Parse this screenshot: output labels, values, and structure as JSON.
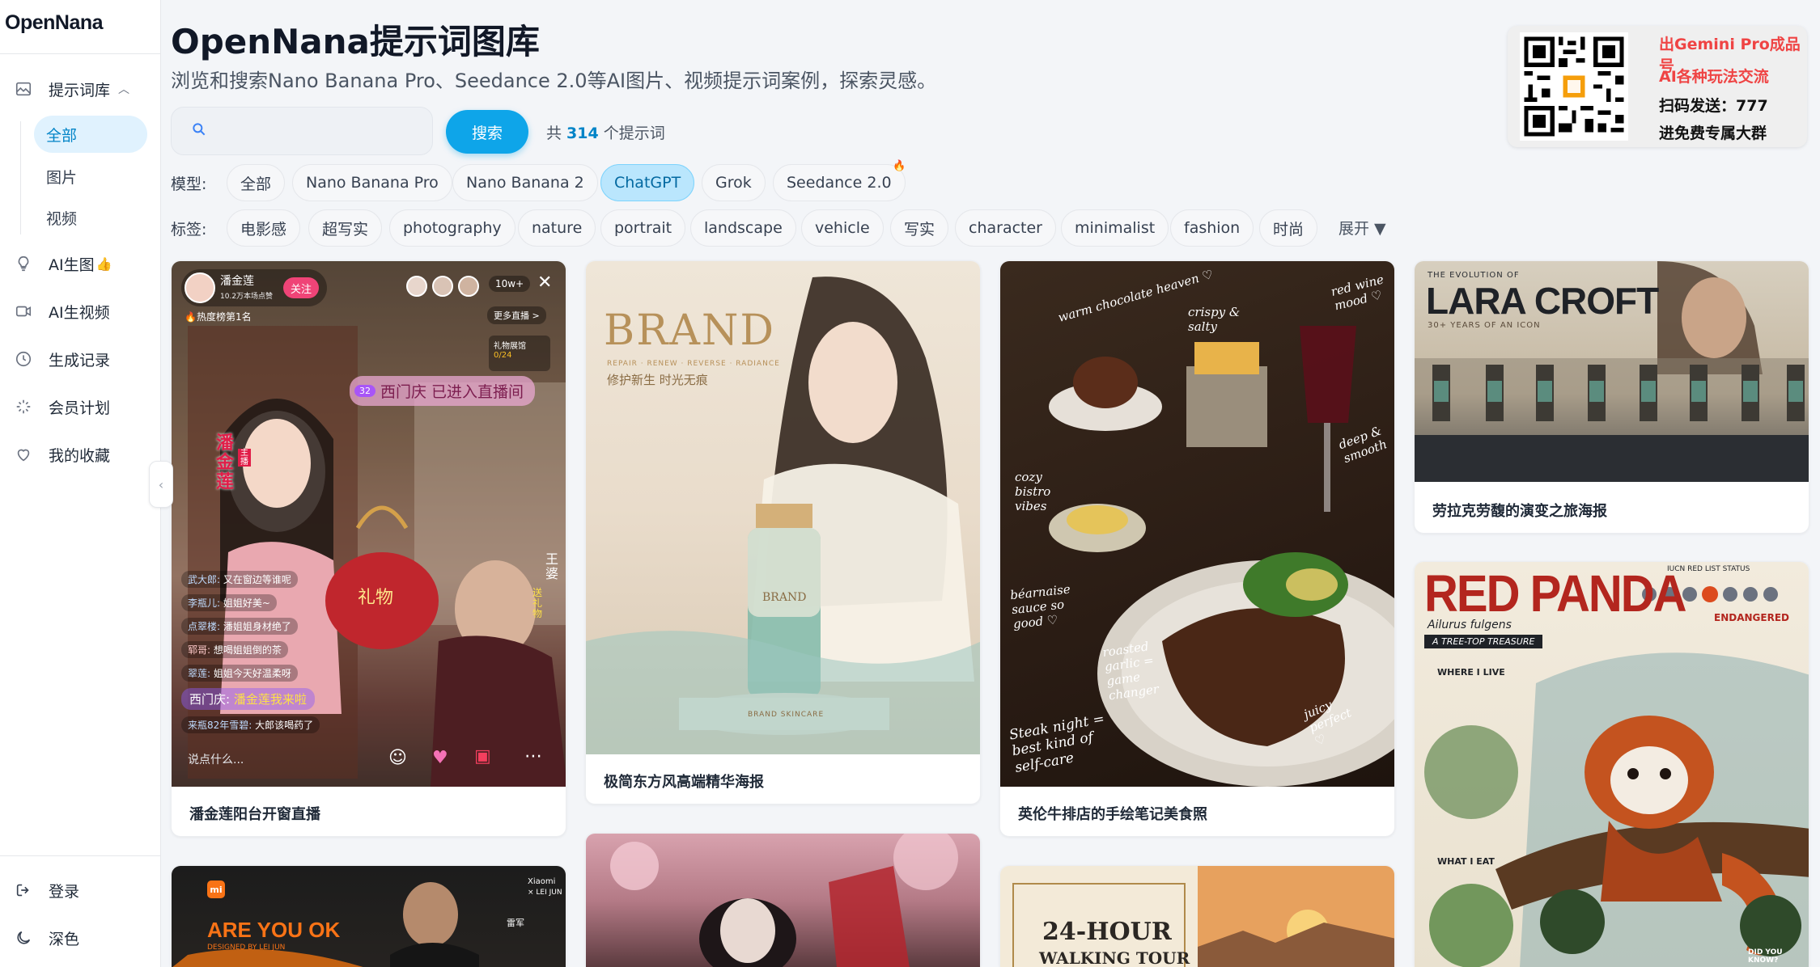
{
  "app": {
    "logo": "OpenNana"
  },
  "sidebar": {
    "prompt_library": "提示词库",
    "sub_items": [
      "全部",
      "图片",
      "视频"
    ],
    "ai_image": "AI生图",
    "ai_image_badge": "👍",
    "ai_video": "AI生视频",
    "history": "生成记录",
    "membership": "会员计划",
    "favorites": "我的收藏",
    "login": "登录",
    "dark": "深色",
    "collapse_glyph": "‹"
  },
  "header": {
    "title": "OpenNana提示词图库",
    "subtitle": "浏览和搜索Nano Banana Pro、Seedance 2.0等AI图片、视频提示词案例，探索灵感。",
    "search_placeholder": "",
    "search_button": "搜索",
    "count_prefix": "共",
    "count_value": "314",
    "count_suffix": "个提示词"
  },
  "filters": {
    "model_label": "模型:",
    "models": [
      "全部",
      "Nano Banana Pro",
      "Nano Banana 2",
      "ChatGPT",
      "Grok",
      "Seedance 2.0"
    ],
    "models_active": "ChatGPT",
    "tag_label": "标签:",
    "tags": [
      "电影感",
      "超写实",
      "photography",
      "nature",
      "portrait",
      "landscape",
      "vehicle",
      "写实",
      "character",
      "minimalist",
      "fashion",
      "时尚"
    ],
    "expand": "展开 ▼"
  },
  "promo": {
    "line1": "出Gemini Pro成品号",
    "line2": "AI各种玩法交流",
    "line3": "扫码发送：777",
    "line4": "进免费专属大群"
  },
  "cards": {
    "c1": {
      "caption": "潘金莲阳台开窗直播",
      "streamer": "潘金莲",
      "followers": "10.2万本场点赞",
      "follow": "关注",
      "viewers": "10w+",
      "rank": "🔥热度榜第1名",
      "more_live": "更多直播 >",
      "gift_panel": "礼物展馆",
      "gift_count": "0/24",
      "banner": "西门庆 已进入直播间",
      "banner_level": "32",
      "side_name": "潘金莲",
      "side_tag": "主播",
      "gift_label": "礼物",
      "side_right": "王婆",
      "side_right2": "送礼物",
      "comments": [
        {
          "user": "武大郎:",
          "text": "又在窗边等谁呢"
        },
        {
          "user": "李瓶儿:",
          "text": "姐姐好美~"
        },
        {
          "user": "点翠楼:",
          "text": "潘姐姐身材绝了"
        },
        {
          "user": "郓哥:",
          "text": "想喝姐姐倒的茶"
        },
        {
          "user": "翠莲:",
          "text": "姐姐今天好温柔呀"
        },
        {
          "user": "西门庆:",
          "text": "潘金莲我来啦"
        },
        {
          "user": "来瓶82年雪碧:",
          "text": "大郎该喝药了"
        }
      ],
      "input_placeholder": "说点什么..."
    },
    "c2": {
      "caption": "极简东方风高端精华海报",
      "brand": "BRAND",
      "brand_sub": "REPAIR · RENEW · REVERSE · RADIANCE",
      "slogan": "修护新生 时光无痕",
      "bottle_brand": "BRAND",
      "base_text": "BRAND SKINCARE"
    },
    "c3": {
      "caption": "英伦牛排店的手绘笔记美食照",
      "notes": [
        "warm chocolate heaven ♡",
        "crispy & salty",
        "red wine mood ♡",
        "cozy bistro vibes",
        "deep & smooth",
        "béarnaise sauce so good ♡",
        "roasted garlic = game changer",
        "juicy perfect ♡",
        "Steak night = best kind of self-care"
      ]
    },
    "c4": {
      "caption": "劳拉克劳馥的演变之旅海报",
      "kicker": "THE EVOLUTION OF",
      "title": "LARA CROFT",
      "sub": "30+ YEARS OF AN ICON"
    },
    "c5": {
      "title": "RED PANDA",
      "latin": "Ailurus fulgens",
      "ribbon": "A TREE-TOP TREASURE",
      "status_title": "IUCN RED LIST STATUS",
      "status": "ENDANGERED",
      "live": "WHERE I LIVE",
      "eat": "WHAT I EAT",
      "know": "DID YOU KNOW?"
    },
    "c6": {
      "brand": "mi",
      "title": "ARE YOU OK",
      "sub": "DESIGNED BY LEI JUN",
      "right1": "Xiaomi",
      "right2": "× LEI JUN",
      "name": "雷军"
    },
    "c8": {
      "title": "24-HOUR",
      "sub": "WALKING TOUR"
    }
  },
  "colors": {
    "accent": "#0ea5e9",
    "active_chip": "#bae6fd",
    "promo_red": "#ef4444"
  }
}
